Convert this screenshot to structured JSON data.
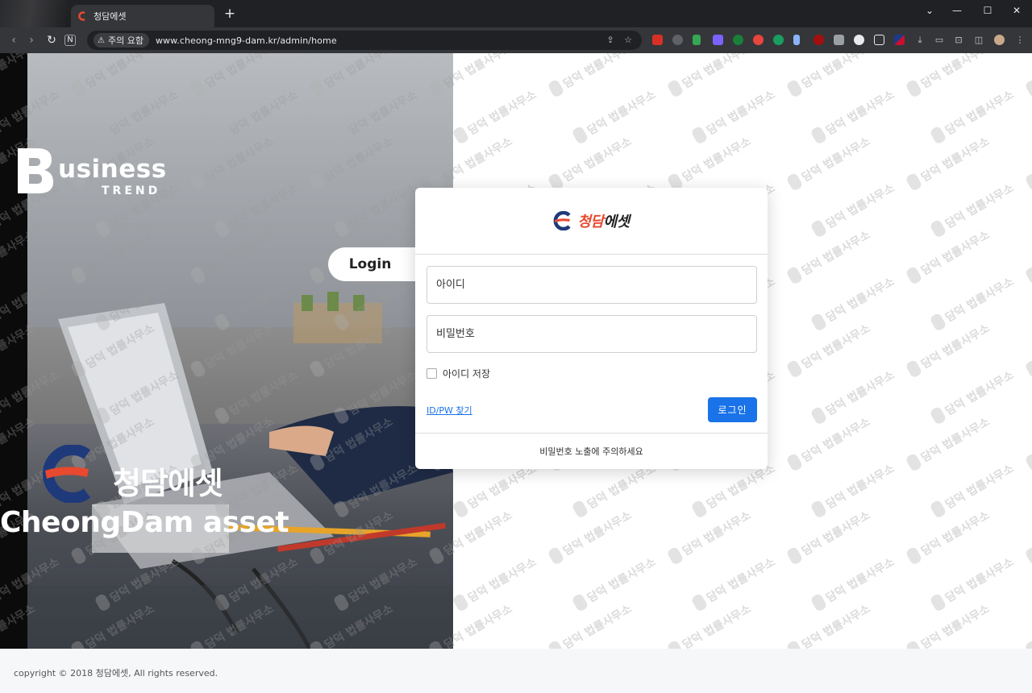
{
  "browser": {
    "tab_title": "청담에셋",
    "new_tab_symbol": "+",
    "security_label": "주의 요함",
    "url": "www.cheong-mng9-dam.kr/admin/home"
  },
  "hero": {
    "brand_letter": "B",
    "brand_word": "usiness",
    "brand_sub": "TREND",
    "login_tab": "Login",
    "company_korean": "청담에셋",
    "company_english": "CheongDam asset"
  },
  "login": {
    "brand_part1": "청담",
    "brand_part2": "에셋",
    "id_placeholder": "아이디",
    "pw_placeholder": "비밀번호",
    "remember_label": "아이디 저장",
    "find_link": "ID/PW 찾기",
    "submit_label": "로그인",
    "notice": "비밀번호 노출에 주의하세요"
  },
  "footer": {
    "copyright": "copyright © 2018 청담에셋, All rights reserved."
  },
  "watermark_text": "담덕 법률사무소",
  "colors": {
    "accent_blue": "#1a73e8",
    "brand_red": "#e8492f",
    "brand_navy": "#1f3a7a"
  }
}
